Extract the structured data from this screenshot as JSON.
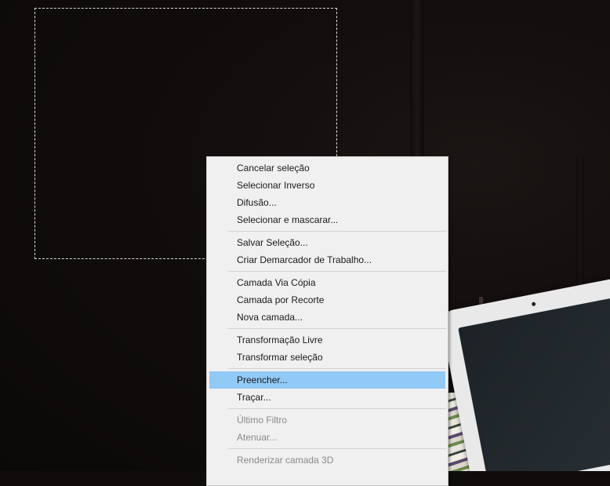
{
  "menu": {
    "items": [
      {
        "label": "Cancelar seleção",
        "enabled": true,
        "highlighted": false
      },
      {
        "label": "Selecionar Inverso",
        "enabled": true,
        "highlighted": false
      },
      {
        "label": "Difusão...",
        "enabled": true,
        "highlighted": false
      },
      {
        "label": "Selecionar e mascarar...",
        "enabled": true,
        "highlighted": false
      },
      {
        "label": "Salvar Seleção...",
        "enabled": true,
        "highlighted": false
      },
      {
        "label": "Criar Demarcador de Trabalho...",
        "enabled": true,
        "highlighted": false
      },
      {
        "label": "Camada Via Cópia",
        "enabled": true,
        "highlighted": false
      },
      {
        "label": "Camada por Recorte",
        "enabled": true,
        "highlighted": false
      },
      {
        "label": "Nova camada...",
        "enabled": true,
        "highlighted": false
      },
      {
        "label": "Transformação Livre",
        "enabled": true,
        "highlighted": false
      },
      {
        "label": "Transformar seleção",
        "enabled": true,
        "highlighted": false
      },
      {
        "label": "Preencher...",
        "enabled": true,
        "highlighted": true
      },
      {
        "label": "Traçar...",
        "enabled": true,
        "highlighted": false
      },
      {
        "label": "Último Filtro",
        "enabled": false,
        "highlighted": false
      },
      {
        "label": "Atenuar...",
        "enabled": false,
        "highlighted": false
      },
      {
        "label": "Renderizar camada 3D",
        "enabled": false,
        "highlighted": false
      }
    ]
  },
  "colors": {
    "highlight": "#91c9f7",
    "menu_background": "#f0f0f0",
    "canvas_background": "#0f0c0b",
    "disabled_text": "#8a8a8a"
  }
}
